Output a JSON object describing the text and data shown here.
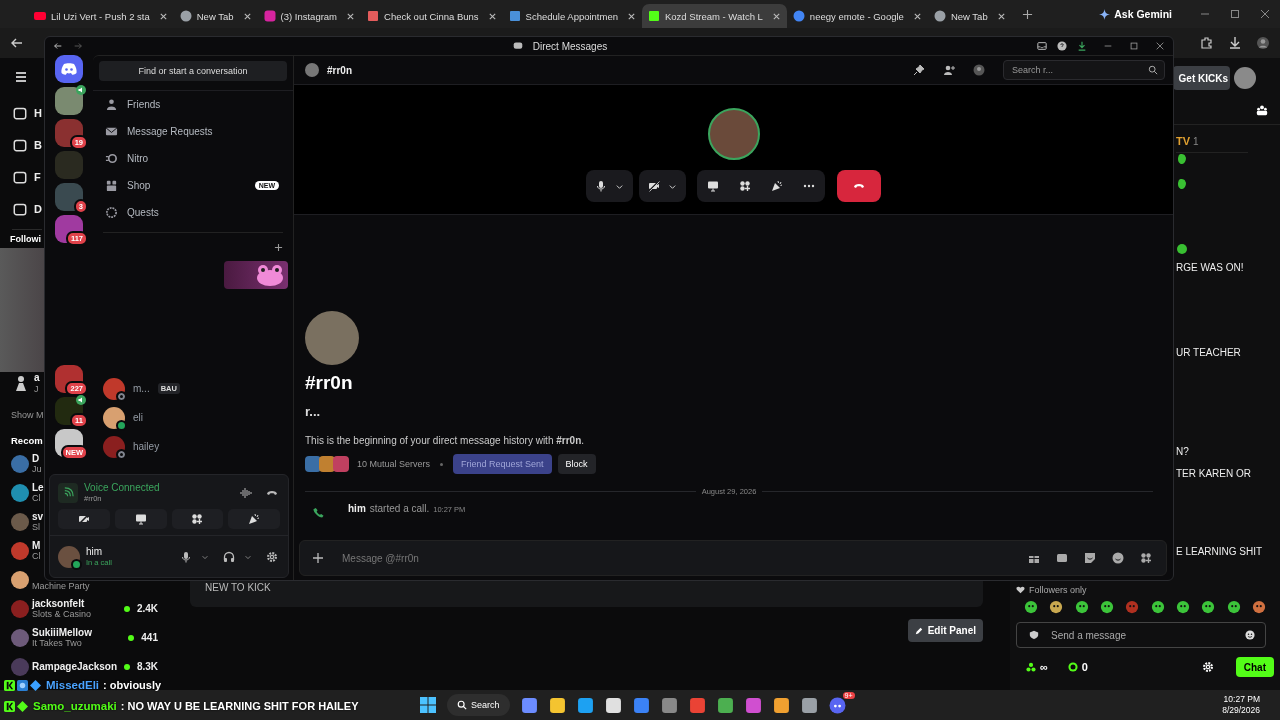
{
  "browser": {
    "tabs": [
      {
        "title": "Lil Uzi Vert - Push 2 sta",
        "kind": "youtube",
        "selected": false
      },
      {
        "title": "New Tab",
        "kind": "chrome",
        "selected": false
      },
      {
        "title": "(3) Instagram",
        "kind": "instagram",
        "selected": false
      },
      {
        "title": "Check out Cinna Buns",
        "kind": "page",
        "selected": false
      },
      {
        "title": "Schedule Appointmen",
        "kind": "calendar",
        "selected": false
      },
      {
        "title": "Kozd Stream - Watch L",
        "kind": "kick",
        "selected": true
      },
      {
        "title": "neegy emote - Google",
        "kind": "google",
        "selected": false
      },
      {
        "title": "New Tab",
        "kind": "chrome",
        "selected": false
      }
    ],
    "ask_gemini": "Ask Gemini"
  },
  "kick": {
    "nav": [
      "H",
      "B",
      "F",
      "D"
    ],
    "following_label": "Followi",
    "followed": [
      {
        "name": "a",
        "sub": "J"
      }
    ],
    "show_more": "Show M",
    "recommended_label": "Recom",
    "recommended": [
      {
        "name": "D",
        "category": "Ju"
      },
      {
        "name": "Le",
        "category": "Cl"
      },
      {
        "name": "sv",
        "category": "Sl"
      },
      {
        "name": "M",
        "category": "Cl"
      },
      {
        "category": "Machine Party"
      },
      {
        "name": "jacksonfelt",
        "category": "Slots & Casino",
        "viewers": "2.4K"
      },
      {
        "name": "SukiiiMellow",
        "category": "It Takes Two",
        "viewers": "441"
      },
      {
        "name": "RampageJackson",
        "viewers": "8.3K"
      }
    ],
    "panel_text": "NEW TO KICK",
    "edit_panel": "Edit Panel"
  },
  "chat": {
    "get_kicks": "Get KICKs",
    "header_name": "TV",
    "header_count": "1",
    "lines": [
      "RGE WAS ON!",
      "UR TEACHER",
      "N?",
      "TER KAREN OR",
      "E LEARNING SHIT"
    ],
    "followers_only": "Followers only",
    "placeholder": "Send a message",
    "points": "∞",
    "kicks": "0",
    "send": "Chat"
  },
  "overlay_chat": [
    {
      "user": "MissedEli",
      "text": ": obviously",
      "color": "#4aa3ff"
    },
    {
      "user": "Samo_uzumaki",
      "text": ": NO WAY U BE LEARNING SHIT FOR HAILEY",
      "color": "#53fc18"
    }
  ],
  "discord": {
    "title": "Direct Messages",
    "servers_upper": [
      {
        "voice": false
      },
      {
        "voice": true
      },
      {
        "badge": "19",
        "voice": false
      },
      {
        "voice": false
      },
      {
        "badge": "3",
        "voice": false
      },
      {
        "badge": "117",
        "voice": false
      }
    ],
    "servers_lower": [
      {
        "badge": "227",
        "voice": false
      },
      {
        "badge": "11",
        "voice": true
      },
      {
        "badge": "NEW",
        "voice": false
      }
    ],
    "search": "Find or start a conversation",
    "nav": [
      {
        "label": "Friends"
      },
      {
        "label": "Message Requests"
      },
      {
        "label": "Nitro"
      },
      {
        "label": "Shop",
        "badge": "NEW"
      },
      {
        "label": "Quests"
      }
    ],
    "dms": [
      {
        "name": "m...",
        "tag": "BAU",
        "online": false
      },
      {
        "name": "eli",
        "online": true
      },
      {
        "name": "hailey",
        "online": false
      }
    ],
    "voice": {
      "status": "Voice Connected",
      "channel": "#rr0n"
    },
    "user": {
      "name": "him",
      "status": "In a call"
    },
    "header": {
      "name": "#rr0n",
      "search_placeholder": "Search r..."
    },
    "profile": {
      "name": "#rr0n",
      "subtitle": "r...",
      "intro": "This is the beginning of your direct message history with **#rr0n**.",
      "mutual": "10 Mutual Servers",
      "friend_request": "Friend Request Sent",
      "friend_request_disabled": true,
      "block": "Block"
    },
    "date": "August 29, 2026",
    "messages": [
      {
        "author": "him",
        "text": "started a call.",
        "time": "10:27 PM"
      }
    ],
    "composer_placeholder": "Message @#rr0n"
  },
  "taskbar": {
    "search": "Search",
    "discord_badge": "9+",
    "time": "10:27 PM",
    "date": "8/29/2026"
  }
}
